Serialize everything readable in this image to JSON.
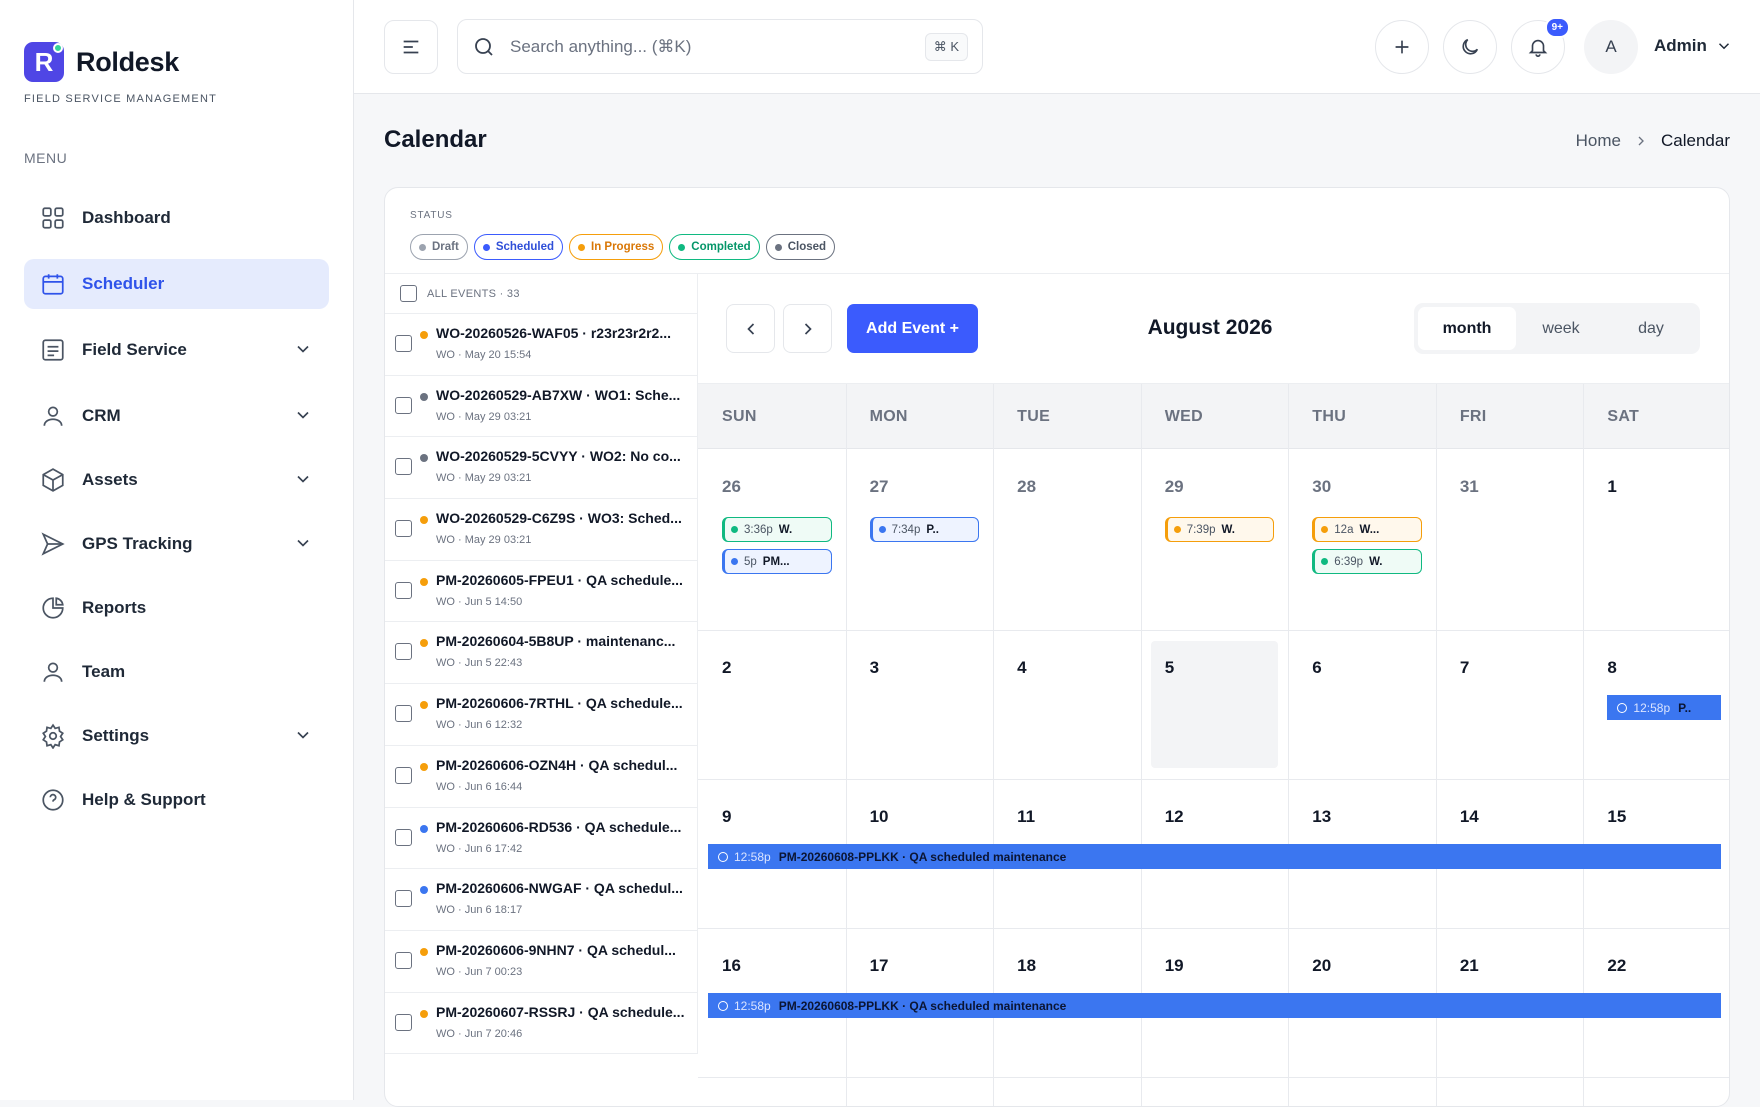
{
  "app": {
    "name": "Roldesk",
    "tagline": "FIELD SERVICE MANAGEMENT",
    "logo_letter": "R"
  },
  "sidebar": {
    "menu_label": "MENU",
    "items": [
      {
        "label": "Dashboard",
        "icon": "grid-icon"
      },
      {
        "label": "Scheduler",
        "icon": "calendar-icon",
        "active": true
      },
      {
        "label": "Field Service",
        "icon": "list-icon",
        "expandable": true
      },
      {
        "label": "CRM",
        "icon": "user-icon",
        "expandable": true
      },
      {
        "label": "Assets",
        "icon": "box-icon",
        "expandable": true
      },
      {
        "label": "GPS Tracking",
        "icon": "send-icon",
        "expandable": true
      },
      {
        "label": "Reports",
        "icon": "pie-chart-icon"
      },
      {
        "label": "Team",
        "icon": "user-icon"
      },
      {
        "label": "Settings",
        "icon": "gear-icon",
        "expandable": true
      },
      {
        "label": "Help & Support",
        "icon": "help-circle-icon"
      }
    ]
  },
  "topbar": {
    "search_placeholder": "Search anything... (⌘K)",
    "shortcut": "⌘ K",
    "notification_badge": "9+",
    "avatar_initial": "A",
    "user_name": "Admin"
  },
  "page": {
    "title": "Calendar",
    "breadcrumb": {
      "home": "Home",
      "current": "Calendar"
    }
  },
  "status": {
    "label": "STATUS",
    "chips": [
      {
        "label": "Draft",
        "color": "#9ca3af",
        "text": "#6b7280"
      },
      {
        "label": "Scheduled",
        "color": "#3b5bfd",
        "text": "#2f4fd8"
      },
      {
        "label": "In Progress",
        "color": "#f59e0b",
        "text": "#d97706"
      },
      {
        "label": "Completed",
        "color": "#10b981",
        "text": "#059669"
      },
      {
        "label": "Closed",
        "color": "#6b7280",
        "text": "#4b5563"
      }
    ]
  },
  "events_list": {
    "header": "ALL EVENTS · 33",
    "items": [
      {
        "title": "WO-20260526-WAF05 · r23r23r2r2...",
        "sub": "WO · May 20 15:54",
        "color": "#f59e0b"
      },
      {
        "title": "WO-20260529-AB7XW · WO1: Sche...",
        "sub": "WO · May 29 03:21",
        "color": "#6b7280"
      },
      {
        "title": "WO-20260529-5CVYY · WO2: No co...",
        "sub": "WO · May 29 03:21",
        "color": "#6b7280"
      },
      {
        "title": "WO-20260529-C6Z9S · WO3: Sched...",
        "sub": "WO · May 29 03:21",
        "color": "#f59e0b"
      },
      {
        "title": "PM-20260605-FPEU1 · QA schedule...",
        "sub": "WO · Jun 5 14:50",
        "color": "#f59e0b"
      },
      {
        "title": "PM-20260604-5B8UP · maintenanc...",
        "sub": "WO · Jun 5 22:43",
        "color": "#f59e0b"
      },
      {
        "title": "PM-20260606-7RTHL · QA schedule...",
        "sub": "WO · Jun 6 12:32",
        "color": "#f59e0b"
      },
      {
        "title": "PM-20260606-OZN4H · QA schedul...",
        "sub": "WO · Jun 6 16:44",
        "color": "#f59e0b"
      },
      {
        "title": "PM-20260606-RD536 · QA schedule...",
        "sub": "WO · Jun 6 17:42",
        "color": "#3b76f0"
      },
      {
        "title": "PM-20260606-NWGAF · QA schedul...",
        "sub": "WO · Jun 6 18:17",
        "color": "#3b76f0"
      },
      {
        "title": "PM-20260606-9NHN7 · QA schedul...",
        "sub": "WO · Jun 7 00:23",
        "color": "#f59e0b"
      },
      {
        "title": "PM-20260607-RSSRJ · QA schedule...",
        "sub": "WO · Jun 7 20:46",
        "color": "#f59e0b"
      }
    ]
  },
  "calendar": {
    "title": "August 2026",
    "add_label": "Add Event +",
    "views": [
      "month",
      "week",
      "day"
    ],
    "active_view": "month",
    "weekdays": [
      "SUN",
      "MON",
      "TUE",
      "WED",
      "THU",
      "FRI",
      "SAT"
    ],
    "weeks": [
      [
        "26",
        "27",
        "28",
        "29",
        "30",
        "31",
        "1"
      ],
      [
        "2",
        "3",
        "4",
        "5",
        "6",
        "7",
        "8"
      ],
      [
        "9",
        "10",
        "11",
        "12",
        "13",
        "14",
        "15"
      ],
      [
        "16",
        "17",
        "18",
        "19",
        "20",
        "21",
        "22"
      ]
    ],
    "today": "5",
    "chip_events": [
      {
        "week": 0,
        "day": 0,
        "slot": 0,
        "time": "3:36p",
        "name": "W.",
        "color": "#10b981"
      },
      {
        "week": 0,
        "day": 0,
        "slot": 1,
        "time": "5p",
        "name": "PM...",
        "color": "#3b76f0"
      },
      {
        "week": 0,
        "day": 1,
        "slot": 0,
        "time": "7:34p",
        "name": "P..",
        "color": "#3b76f0"
      },
      {
        "week": 0,
        "day": 3,
        "slot": 0,
        "time": "7:39p",
        "name": "W.",
        "color": "#f59e0b"
      },
      {
        "week": 0,
        "day": 4,
        "slot": 0,
        "time": "12a",
        "name": "W...",
        "color": "#f59e0b"
      },
      {
        "week": 0,
        "day": 4,
        "slot": 1,
        "time": "6:39p",
        "name": "W.",
        "color": "#10b981"
      }
    ],
    "bar_events": [
      {
        "week": 1,
        "start": 6,
        "end": 6,
        "time": "12:58p",
        "name": "P.."
      },
      {
        "week": 2,
        "start": 0,
        "end": 6,
        "time": "12:58p",
        "name": "PM-20260608-PPLKK · QA scheduled maintenance"
      },
      {
        "week": 3,
        "start": 0,
        "end": 6,
        "time": "12:58p",
        "name": "PM-20260608-PPLKK · QA scheduled maintenance"
      }
    ]
  }
}
